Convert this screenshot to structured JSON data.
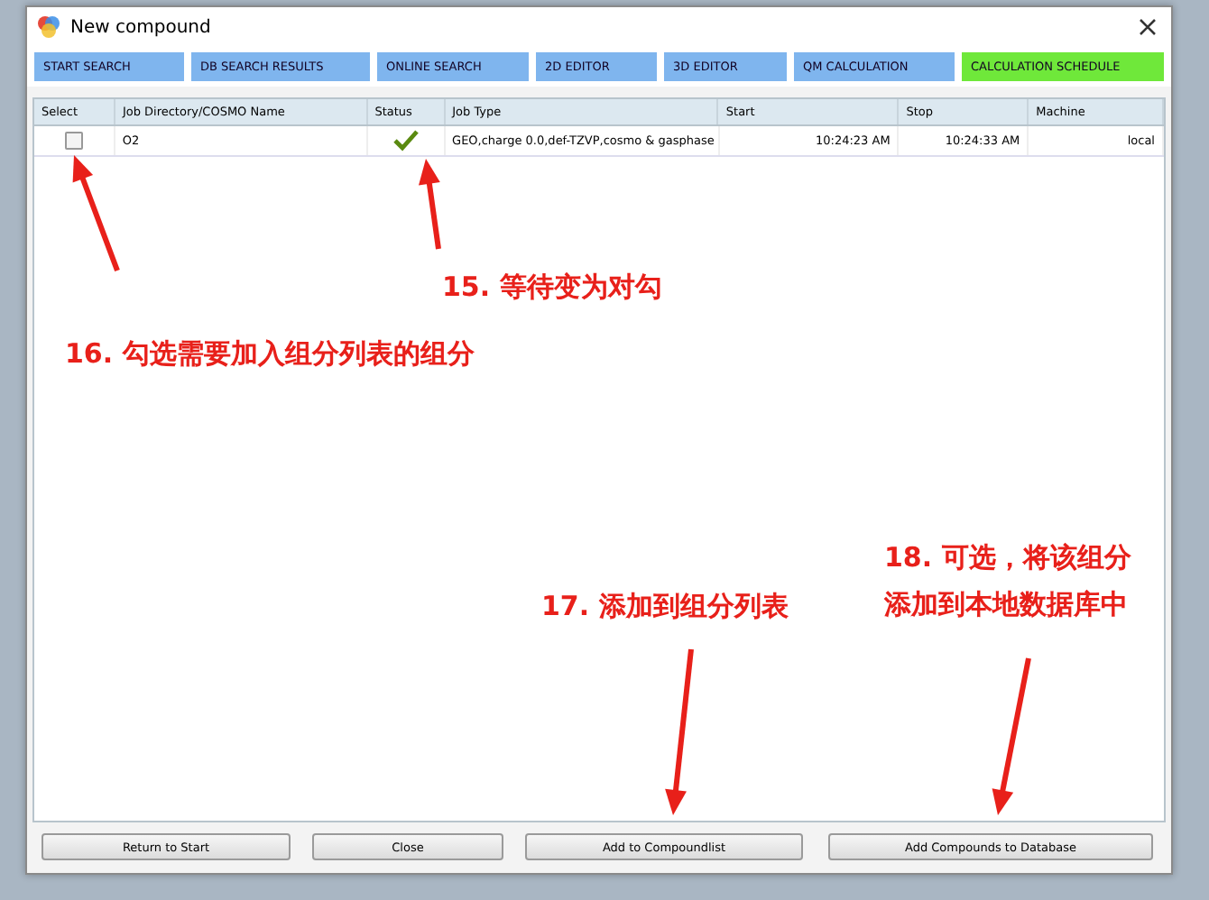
{
  "window": {
    "title": "New compound"
  },
  "tabs": [
    {
      "label": "START SEARCH",
      "selected": false
    },
    {
      "label": "DB SEARCH RESULTS",
      "selected": false
    },
    {
      "label": "ONLINE SEARCH",
      "selected": false
    },
    {
      "label": "2D EDITOR",
      "selected": false
    },
    {
      "label": "3D EDITOR",
      "selected": false
    },
    {
      "label": "QM CALCULATION",
      "selected": false
    },
    {
      "label": "CALCULATION SCHEDULE",
      "selected": true
    }
  ],
  "table": {
    "columns": [
      "Select",
      "Job Directory/COSMO Name",
      "Status",
      "Job Type",
      "Start",
      "Stop",
      "Machine"
    ],
    "rows": [
      {
        "checked": false,
        "name": "O2",
        "completed": true,
        "job_type": "GEO,charge 0.0,def-TZVP,cosmo & gasphase",
        "start": "10:24:23 AM",
        "stop": "10:24:33 AM",
        "machine": "local"
      }
    ]
  },
  "buttons": [
    "Return to Start",
    "Close",
    "Add to Compoundlist",
    "Add Compounds to Database"
  ],
  "annotations": [
    {
      "text": "15. 等待变为对勾"
    },
    {
      "text": "16. 勾选需要加入组分列表的组分"
    },
    {
      "text": "17. 添加到组分列表"
    },
    {
      "text": "18. 可选，将该组分"
    },
    {
      "text": "添加到本地数据库中"
    }
  ]
}
